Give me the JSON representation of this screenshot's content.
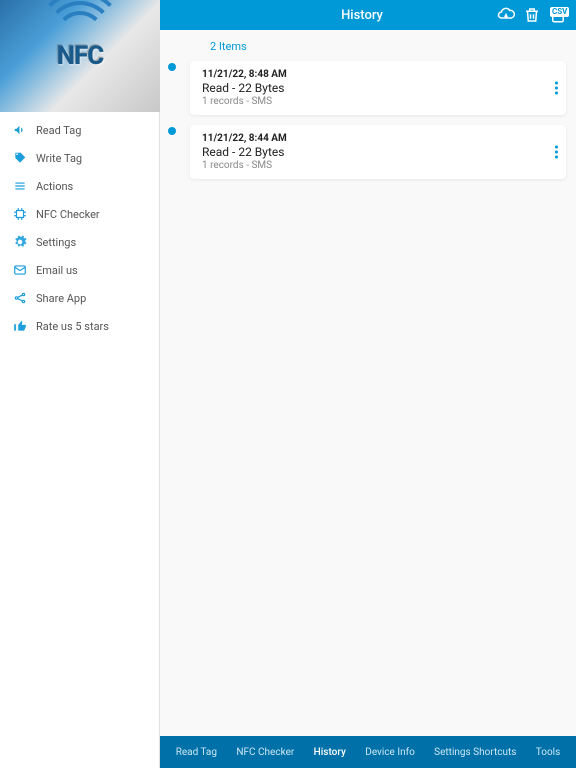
{
  "logo": {
    "text": "NFC"
  },
  "sidebar": {
    "items": [
      {
        "label": "Read Tag"
      },
      {
        "label": "Write Tag"
      },
      {
        "label": "Actions"
      },
      {
        "label": "NFC Checker"
      },
      {
        "label": "Settings"
      },
      {
        "label": "Email us"
      },
      {
        "label": "Share App"
      },
      {
        "label": "Rate us 5 stars"
      }
    ]
  },
  "header": {
    "title": "History",
    "csv_label": "CSV"
  },
  "content": {
    "count_label": "2 Items",
    "history": [
      {
        "date": "11/21/22, 8:48 AM",
        "title": "Read - 22 Bytes",
        "sub": "1 records - SMS"
      },
      {
        "date": "11/21/22, 8:44 AM",
        "title": "Read - 22 Bytes",
        "sub": "1 records - SMS"
      }
    ]
  },
  "tabs": [
    {
      "label": "Read Tag",
      "active": false
    },
    {
      "label": "NFC Checker",
      "active": false
    },
    {
      "label": "History",
      "active": true
    },
    {
      "label": "Device Info",
      "active": false
    },
    {
      "label": "Settings Shortcuts",
      "active": false
    },
    {
      "label": "Tools",
      "active": false
    }
  ]
}
